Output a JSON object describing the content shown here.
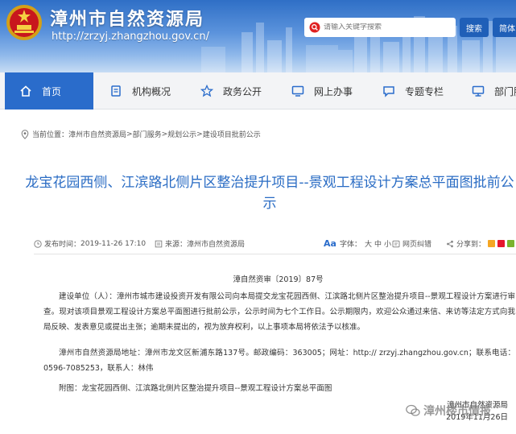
{
  "header": {
    "title": "漳州市自然资源局",
    "url": "http://zrzyj.zhangzhou.gov.cn/",
    "search_placeholder": "请输入关键字搜索",
    "search_button": "搜索",
    "simple_button": "简体"
  },
  "nav": {
    "items": [
      {
        "label": "首页",
        "icon": "home-icon"
      },
      {
        "label": "机构概况",
        "icon": "document-icon"
      },
      {
        "label": "政务公开",
        "icon": "star-icon"
      },
      {
        "label": "网上办事",
        "icon": "monitor-icon"
      },
      {
        "label": "专题专栏",
        "icon": "chat-icon"
      },
      {
        "label": "部门服",
        "icon": "computer-icon"
      }
    ]
  },
  "breadcrumb": {
    "prefix": "当前位置：",
    "items": [
      "漳州市自然资源局",
      "部门服务",
      "规划公示",
      "建设项目批前公示"
    ],
    "separator": ">"
  },
  "article": {
    "title": "龙宝花园西侧、江滨路北侧片区整治提升项目--景观工程设计方案总平面图批前公示",
    "publish_label": "发布时间：",
    "publish_time": "2019-11-26 17:10",
    "source_label": "来源：",
    "source": "漳州市自然资源局",
    "font_label": "字体：",
    "font_sizes": [
      "大",
      "中",
      "小"
    ],
    "error_label": "网页纠错",
    "share_label": "分享到：",
    "doc_number": "漳自然资审〔2019〕87号",
    "paragraphs": [
      "建设单位（人）：漳州市城市建设投资开发有限公司向本局提交龙宝花园西侧、江滨路北侧片区整治提升项目--景观工程设计方案进行审查。现对该项目景观工程设计方案总平面图进行批前公示，公示时间为七个工作日。公示期限内，欢迎公众通过来信、来访等法定方式向我局反映、发表意见或提出主张；逾期未提出的，视为放弃权利，以上事项本局将依法予以核准。",
      "漳州市自然资源局地址：漳州市龙文区新浦东路137号。邮政编码：363005；网址：http:// zrzyj.zhangzhou.gov.cn；联系电话：0596-7085253，联系人：林伟",
      "附图：龙宝花园西侧、江滨路北侧片区整治提升项目--景观工程设计方案总平面图"
    ],
    "signature_org": "漳州市自然资源局",
    "signature_date": "2019年11月26日"
  },
  "watermark": {
    "text": "漳州楼市情报"
  },
  "colors": {
    "nav_active": "#2a6ccb",
    "title_blue": "#2a6cc4",
    "banner_top": "#2f6fc6"
  }
}
